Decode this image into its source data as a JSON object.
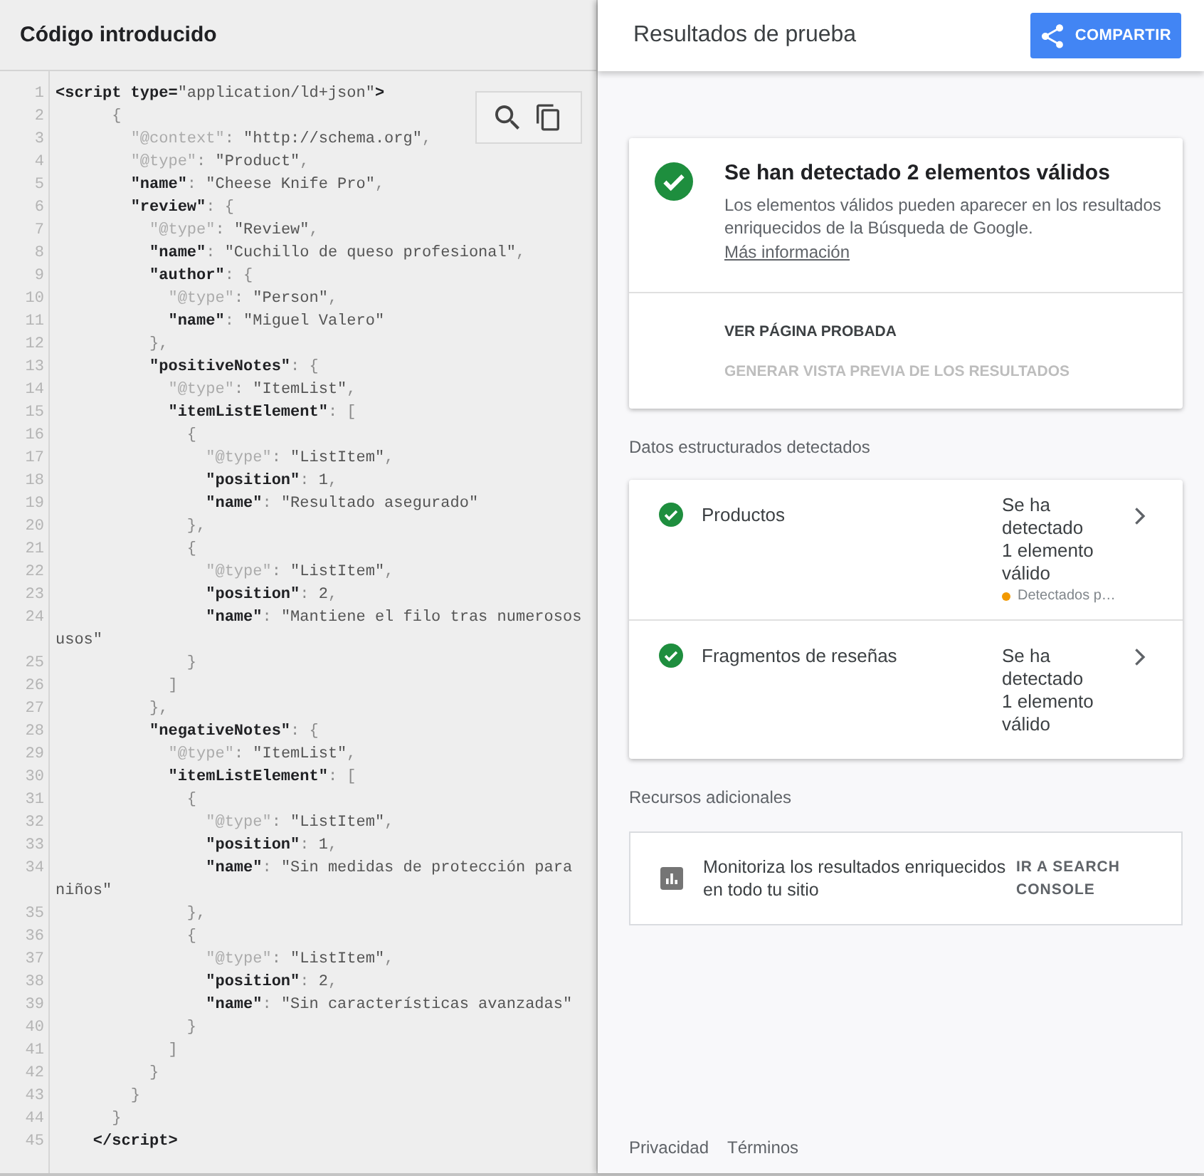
{
  "code_panel": {
    "title": "Código introducido",
    "lines": [
      {
        "number": "1",
        "parts": [
          {
            "kind": "tag",
            "text": "<script type="
          },
          {
            "kind": "string",
            "text": "\"application/ld+json\""
          },
          {
            "kind": "tag",
            "text": ">"
          }
        ]
      },
      {
        "number": "2",
        "parts": [
          {
            "kind": "punct",
            "text": "      {"
          }
        ]
      },
      {
        "number": "3",
        "parts": [
          {
            "kind": "meta",
            "text": "        \"@context\""
          },
          {
            "kind": "punct",
            "text": ": "
          },
          {
            "kind": "string",
            "text": "\"http://schema.org\""
          },
          {
            "kind": "punct",
            "text": ","
          }
        ]
      },
      {
        "number": "4",
        "parts": [
          {
            "kind": "meta",
            "text": "        \"@type\""
          },
          {
            "kind": "punct",
            "text": ": "
          },
          {
            "kind": "string",
            "text": "\"Product\""
          },
          {
            "kind": "punct",
            "text": ","
          }
        ]
      },
      {
        "number": "5",
        "parts": [
          {
            "kind": "key",
            "text": "        \"name\""
          },
          {
            "kind": "punct",
            "text": ": "
          },
          {
            "kind": "string",
            "text": "\"Cheese Knife Pro\""
          },
          {
            "kind": "punct",
            "text": ","
          }
        ]
      },
      {
        "number": "6",
        "parts": [
          {
            "kind": "key",
            "text": "        \"review\""
          },
          {
            "kind": "punct",
            "text": ": {"
          }
        ]
      },
      {
        "number": "7",
        "parts": [
          {
            "kind": "meta",
            "text": "          \"@type\""
          },
          {
            "kind": "punct",
            "text": ": "
          },
          {
            "kind": "string",
            "text": "\"Review\""
          },
          {
            "kind": "punct",
            "text": ","
          }
        ]
      },
      {
        "number": "8",
        "parts": [
          {
            "kind": "key",
            "text": "          \"name\""
          },
          {
            "kind": "punct",
            "text": ": "
          },
          {
            "kind": "string",
            "text": "\"Cuchillo de queso profesional\""
          },
          {
            "kind": "punct",
            "text": ","
          }
        ]
      },
      {
        "number": "9",
        "parts": [
          {
            "kind": "key",
            "text": "          \"author\""
          },
          {
            "kind": "punct",
            "text": ": {"
          }
        ]
      },
      {
        "number": "10",
        "parts": [
          {
            "kind": "meta",
            "text": "            \"@type\""
          },
          {
            "kind": "punct",
            "text": ": "
          },
          {
            "kind": "string",
            "text": "\"Person\""
          },
          {
            "kind": "punct",
            "text": ","
          }
        ]
      },
      {
        "number": "11",
        "parts": [
          {
            "kind": "key",
            "text": "            \"name\""
          },
          {
            "kind": "punct",
            "text": ": "
          },
          {
            "kind": "string",
            "text": "\"Miguel Valero\""
          }
        ]
      },
      {
        "number": "12",
        "parts": [
          {
            "kind": "punct",
            "text": "          },"
          }
        ]
      },
      {
        "number": "13",
        "parts": [
          {
            "kind": "key",
            "text": "          \"positiveNotes\""
          },
          {
            "kind": "punct",
            "text": ": {"
          }
        ]
      },
      {
        "number": "14",
        "parts": [
          {
            "kind": "meta",
            "text": "            \"@type\""
          },
          {
            "kind": "punct",
            "text": ": "
          },
          {
            "kind": "string",
            "text": "\"ItemList\""
          },
          {
            "kind": "punct",
            "text": ","
          }
        ]
      },
      {
        "number": "15",
        "parts": [
          {
            "kind": "key",
            "text": "            \"itemListElement\""
          },
          {
            "kind": "punct",
            "text": ": ["
          }
        ]
      },
      {
        "number": "16",
        "parts": [
          {
            "kind": "punct",
            "text": "              {"
          }
        ]
      },
      {
        "number": "17",
        "parts": [
          {
            "kind": "meta",
            "text": "                \"@type\""
          },
          {
            "kind": "punct",
            "text": ": "
          },
          {
            "kind": "string",
            "text": "\"ListItem\""
          },
          {
            "kind": "punct",
            "text": ","
          }
        ]
      },
      {
        "number": "18",
        "parts": [
          {
            "kind": "key",
            "text": "                \"position\""
          },
          {
            "kind": "punct",
            "text": ": "
          },
          {
            "kind": "number",
            "text": "1"
          },
          {
            "kind": "punct",
            "text": ","
          }
        ]
      },
      {
        "number": "19",
        "parts": [
          {
            "kind": "key",
            "text": "                \"name\""
          },
          {
            "kind": "punct",
            "text": ": "
          },
          {
            "kind": "string",
            "text": "\"Resultado asegurado\""
          }
        ]
      },
      {
        "number": "20",
        "parts": [
          {
            "kind": "punct",
            "text": "              },"
          }
        ]
      },
      {
        "number": "21",
        "parts": [
          {
            "kind": "punct",
            "text": "              {"
          }
        ]
      },
      {
        "number": "22",
        "parts": [
          {
            "kind": "meta",
            "text": "                \"@type\""
          },
          {
            "kind": "punct",
            "text": ": "
          },
          {
            "kind": "string",
            "text": "\"ListItem\""
          },
          {
            "kind": "punct",
            "text": ","
          }
        ]
      },
      {
        "number": "23",
        "parts": [
          {
            "kind": "key",
            "text": "                \"position\""
          },
          {
            "kind": "punct",
            "text": ": "
          },
          {
            "kind": "number",
            "text": "2"
          },
          {
            "kind": "punct",
            "text": ","
          }
        ]
      },
      {
        "number": "24",
        "parts": [
          {
            "kind": "key",
            "text": "                \"name\""
          },
          {
            "kind": "punct",
            "text": ": "
          },
          {
            "kind": "string",
            "text": "\"Mantiene el filo tras numerosos usos\""
          }
        ]
      },
      {
        "number": "25",
        "parts": [
          {
            "kind": "punct",
            "text": "              }"
          }
        ]
      },
      {
        "number": "26",
        "parts": [
          {
            "kind": "punct",
            "text": "            ]"
          }
        ]
      },
      {
        "number": "27",
        "parts": [
          {
            "kind": "punct",
            "text": "          },"
          }
        ]
      },
      {
        "number": "28",
        "parts": [
          {
            "kind": "key",
            "text": "          \"negativeNotes\""
          },
          {
            "kind": "punct",
            "text": ": {"
          }
        ]
      },
      {
        "number": "29",
        "parts": [
          {
            "kind": "meta",
            "text": "            \"@type\""
          },
          {
            "kind": "punct",
            "text": ": "
          },
          {
            "kind": "string",
            "text": "\"ItemList\""
          },
          {
            "kind": "punct",
            "text": ","
          }
        ]
      },
      {
        "number": "30",
        "parts": [
          {
            "kind": "key",
            "text": "            \"itemListElement\""
          },
          {
            "kind": "punct",
            "text": ": ["
          }
        ]
      },
      {
        "number": "31",
        "parts": [
          {
            "kind": "punct",
            "text": "              {"
          }
        ]
      },
      {
        "number": "32",
        "parts": [
          {
            "kind": "meta",
            "text": "                \"@type\""
          },
          {
            "kind": "punct",
            "text": ": "
          },
          {
            "kind": "string",
            "text": "\"ListItem\""
          },
          {
            "kind": "punct",
            "text": ","
          }
        ]
      },
      {
        "number": "33",
        "parts": [
          {
            "kind": "key",
            "text": "                \"position\""
          },
          {
            "kind": "punct",
            "text": ": "
          },
          {
            "kind": "number",
            "text": "1"
          },
          {
            "kind": "punct",
            "text": ","
          }
        ]
      },
      {
        "number": "34",
        "parts": [
          {
            "kind": "key",
            "text": "                \"name\""
          },
          {
            "kind": "punct",
            "text": ": "
          },
          {
            "kind": "string",
            "text": "\"Sin medidas de protección para niños\""
          }
        ]
      },
      {
        "number": "35",
        "parts": [
          {
            "kind": "punct",
            "text": "              },"
          }
        ]
      },
      {
        "number": "36",
        "parts": [
          {
            "kind": "punct",
            "text": "              {"
          }
        ]
      },
      {
        "number": "37",
        "parts": [
          {
            "kind": "meta",
            "text": "                \"@type\""
          },
          {
            "kind": "punct",
            "text": ": "
          },
          {
            "kind": "string",
            "text": "\"ListItem\""
          },
          {
            "kind": "punct",
            "text": ","
          }
        ]
      },
      {
        "number": "38",
        "parts": [
          {
            "kind": "key",
            "text": "                \"position\""
          },
          {
            "kind": "punct",
            "text": ": "
          },
          {
            "kind": "number",
            "text": "2"
          },
          {
            "kind": "punct",
            "text": ","
          }
        ]
      },
      {
        "number": "39",
        "parts": [
          {
            "kind": "key",
            "text": "                \"name\""
          },
          {
            "kind": "punct",
            "text": ": "
          },
          {
            "kind": "string",
            "text": "\"Sin características avanzadas\""
          }
        ]
      },
      {
        "number": "40",
        "parts": [
          {
            "kind": "punct",
            "text": "              }"
          }
        ]
      },
      {
        "number": "41",
        "parts": [
          {
            "kind": "punct",
            "text": "            ]"
          }
        ]
      },
      {
        "number": "42",
        "parts": [
          {
            "kind": "punct",
            "text": "          }"
          }
        ]
      },
      {
        "number": "43",
        "parts": [
          {
            "kind": "punct",
            "text": "        }"
          }
        ]
      },
      {
        "number": "44",
        "parts": [
          {
            "kind": "punct",
            "text": "      }"
          }
        ]
      },
      {
        "number": "45",
        "parts": [
          {
            "kind": "tag",
            "text": "    </script>"
          }
        ]
      }
    ]
  },
  "results_panel": {
    "title": "Resultados de prueba",
    "share_button": "COMPARTIR",
    "summary": {
      "valid": true,
      "title": "Se han detectado 2 elementos válidos",
      "description": "Los elementos válidos pueden aparecer en los resultados enriquecidos de la Búsqueda de Google.",
      "link": "Más información",
      "actions": [
        {
          "label": "VER PÁGINA PROBADA",
          "disabled": false
        },
        {
          "label": "GENERAR VISTA PREVIA DE LOS RESULTADOS",
          "disabled": true
        }
      ]
    },
    "detected": {
      "heading": "Datos estructurados detectados",
      "items": [
        {
          "name": "Productos",
          "valid": true,
          "status": "Se ha detectado 1 elemento válido",
          "note": "Detectados p…"
        },
        {
          "name": "Fragmentos de reseñas",
          "valid": true,
          "status": "Se ha detectado 1 elemento válido"
        }
      ]
    },
    "resources": {
      "heading": "Recursos adicionales",
      "items": [
        {
          "text": "Monitoriza los resultados enriquecidos en todo tu sitio",
          "link": "IR A SEARCH CONSOLE"
        }
      ]
    },
    "footer_links": [
      "Privacidad",
      "Términos"
    ]
  }
}
